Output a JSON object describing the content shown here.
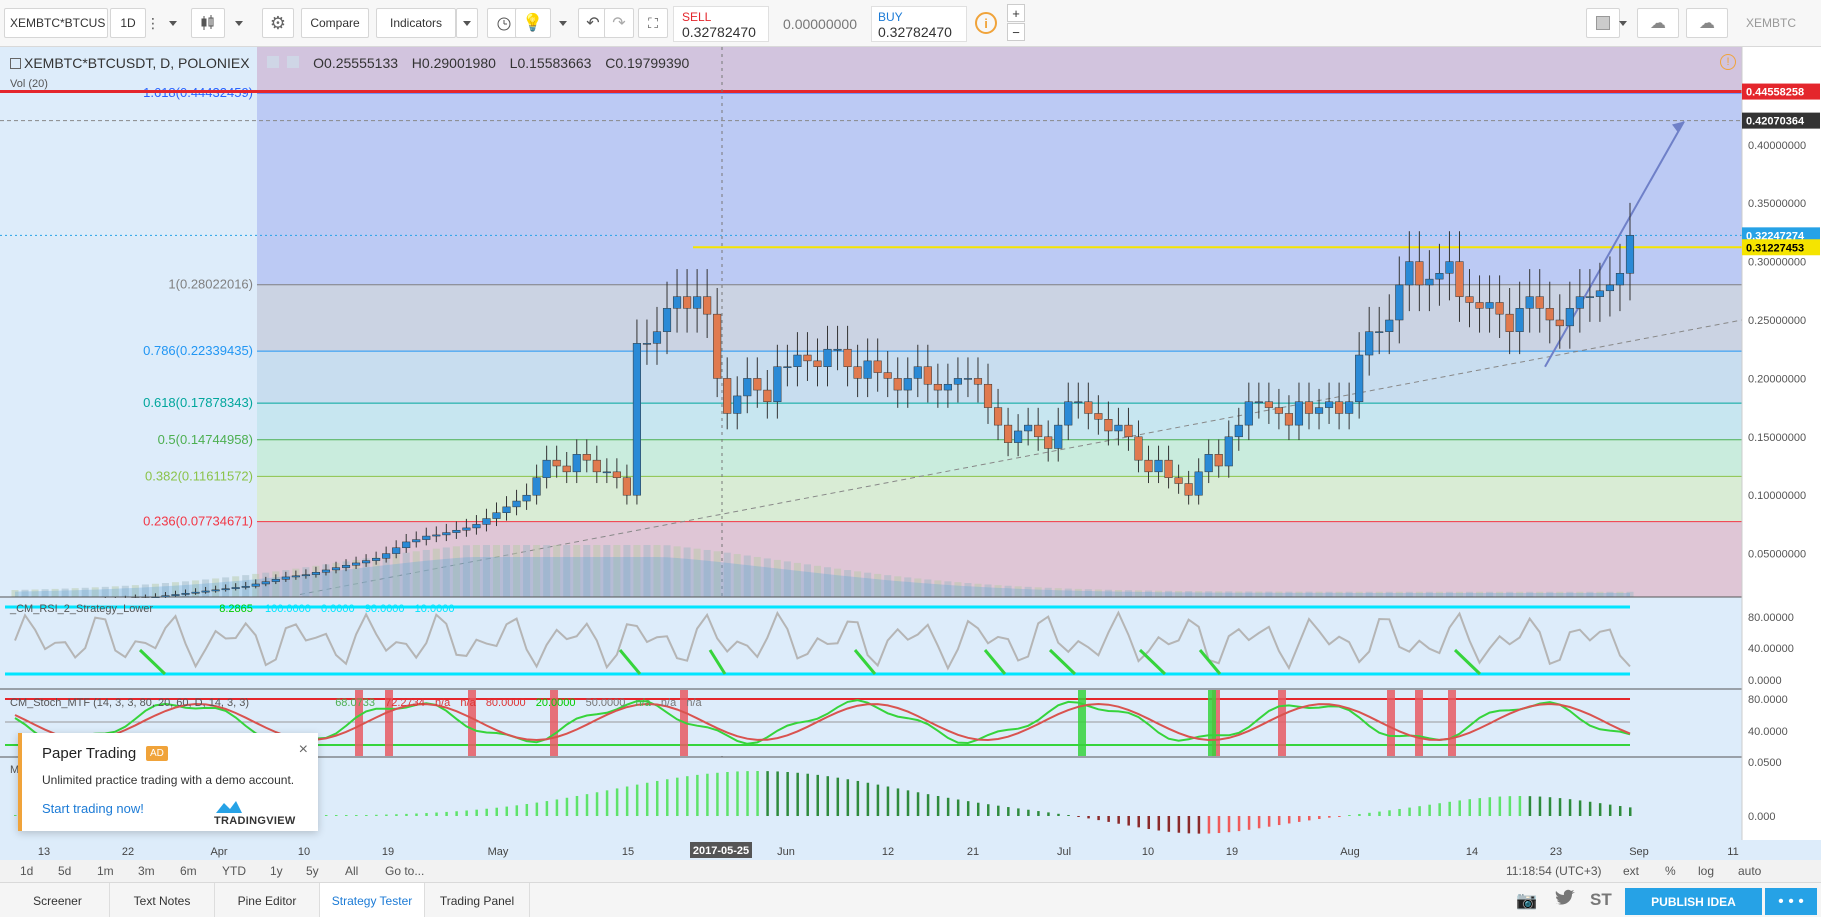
{
  "toolbar": {
    "symbol": "XEMBTC*BTCUS",
    "interval": "1D",
    "compare_label": "Compare",
    "indicators_label": "Indicators",
    "sell_label": "SELL",
    "sell_price": "0.32782470",
    "spread": "0.00000000",
    "buy_label": "BUY",
    "buy_price": "0.32782470",
    "info_icon": "i",
    "right_symbol": "XEMBTC"
  },
  "legend": {
    "title": "XEMBTC*BTCUSDT, D, POLONIEX",
    "open": "0.25555133",
    "high": "0.29001980",
    "low": "0.15583663",
    "close": "0.19799390",
    "vol_label": "Vol (20)"
  },
  "fib_levels": [
    {
      "label": "1.618(0.44432459)",
      "value": 0.44432459,
      "color": "#2962ff"
    },
    {
      "label": "1(0.28022016)",
      "value": 0.28022016,
      "color": "#808080"
    },
    {
      "label": "0.786(0.22339435)",
      "value": 0.22339435,
      "color": "#2196f3"
    },
    {
      "label": "0.618(0.17878343)",
      "value": 0.17878343,
      "color": "#00a69c"
    },
    {
      "label": "0.5(0.14744958)",
      "value": 0.14744958,
      "color": "#4caf50"
    },
    {
      "label": "0.382(0.11611572)",
      "value": 0.11611572,
      "color": "#8bc34a"
    },
    {
      "label": "0.236(0.07734671)",
      "value": 0.07734671,
      "color": "#f23645"
    }
  ],
  "price_scale": {
    "ticks": [
      "0.40000000",
      "0.35000000",
      "0.30000000",
      "0.25000000",
      "0.20000000",
      "0.15000000",
      "0.10000000",
      "0.05000000"
    ],
    "tick_values": [
      0.4,
      0.35,
      0.3,
      0.25,
      0.2,
      0.15,
      0.1,
      0.05
    ],
    "labels": [
      {
        "text": "0.44558258",
        "value": 0.44558258,
        "color": "#e4262c"
      },
      {
        "text": "0.42070364",
        "value": 0.42070364,
        "color": "#333333"
      },
      {
        "text": "0.32247274",
        "value": 0.32247274,
        "color": "#26a2e6"
      },
      {
        "text": "0.31227453",
        "value": 0.31227453,
        "color": "#f5e400"
      }
    ]
  },
  "rsi": {
    "label": "_CM_RSI_2_Strategy_Lower",
    "value": "8.2865",
    "upper": "100.0000",
    "lower": "0.0000",
    "ob": "90.0000",
    "os": "10.0000",
    "ticks": [
      "80.00000",
      "40.00000",
      "0.0000"
    ]
  },
  "stoch": {
    "label": "CM_Stoch_MTF (14, 3, 3, 80, 20, 60, D, 14, 3, 3)",
    "v1": "68.0733",
    "v2": "72.2734",
    "v3": "n/a",
    "v4": "n/a",
    "v5": "80.0000",
    "v6": "20.0000",
    "v7": "50.0000",
    "v8": "n/a",
    "v9": "n/a",
    "v10": "n/a",
    "ticks": [
      "80.0000",
      "40.0000"
    ]
  },
  "macd": {
    "label": "M",
    "ticks": [
      "0.0500",
      "0.000"
    ]
  },
  "time_axis": {
    "labels": [
      "13",
      "22",
      "Apr",
      "10",
      "19",
      "May",
      "15",
      "Jun",
      "12",
      "21",
      "Jul",
      "10",
      "19",
      "Aug",
      "14",
      "23",
      "Sep",
      "11"
    ],
    "highlight": "2017-05-25"
  },
  "bottom": {
    "ranges": [
      "1d",
      "5d",
      "1m",
      "3m",
      "6m",
      "YTD",
      "1y",
      "5y",
      "All"
    ],
    "goto": "Go to...",
    "clock": "11:18:54 (UTC+3)",
    "ext": "ext",
    "pct": "%",
    "log": "log",
    "auto": "auto"
  },
  "popup": {
    "title": "Paper Trading",
    "badge": "AD",
    "text": "Unlimited practice trading with a demo account.",
    "link": "Start trading now!",
    "brand": "TRADINGVIEW",
    "close": "×"
  },
  "footer": {
    "tabs": [
      "Screener",
      "Text Notes",
      "Pine Editor",
      "Strategy Tester",
      "Trading Panel"
    ],
    "active": "Strategy Tester",
    "publish": "PUBLISH IDEA",
    "more": "• • •",
    "st": "ST"
  },
  "chart_data": {
    "type": "candlestick",
    "symbol": "XEMBTC*BTCUSDT",
    "x_labels": [
      "13",
      "22",
      "Apr",
      "10",
      "19",
      "May",
      "15",
      "Jun",
      "12",
      "21",
      "Jul",
      "10",
      "19",
      "Aug",
      "14",
      "23",
      "Sep"
    ],
    "ylim": [
      0.0,
      0.46
    ],
    "closes": [
      0.005,
      0.006,
      0.006,
      0.007,
      0.007,
      0.008,
      0.008,
      0.008,
      0.009,
      0.01,
      0.01,
      0.011,
      0.012,
      0.012,
      0.013,
      0.014,
      0.015,
      0.016,
      0.017,
      0.018,
      0.019,
      0.02,
      0.021,
      0.022,
      0.024,
      0.026,
      0.028,
      0.03,
      0.031,
      0.032,
      0.034,
      0.036,
      0.038,
      0.04,
      0.042,
      0.044,
      0.046,
      0.05,
      0.055,
      0.06,
      0.062,
      0.065,
      0.066,
      0.068,
      0.07,
      0.072,
      0.075,
      0.08,
      0.085,
      0.09,
      0.095,
      0.1,
      0.115,
      0.13,
      0.125,
      0.12,
      0.135,
      0.13,
      0.12,
      0.12,
      0.115,
      0.1,
      0.23,
      0.23,
      0.24,
      0.26,
      0.27,
      0.26,
      0.27,
      0.255,
      0.2,
      0.17,
      0.185,
      0.2,
      0.19,
      0.18,
      0.21,
      0.21,
      0.22,
      0.215,
      0.21,
      0.225,
      0.225,
      0.21,
      0.2,
      0.215,
      0.205,
      0.2,
      0.19,
      0.2,
      0.21,
      0.195,
      0.19,
      0.195,
      0.2,
      0.2,
      0.195,
      0.175,
      0.16,
      0.145,
      0.155,
      0.16,
      0.15,
      0.14,
      0.16,
      0.18,
      0.18,
      0.17,
      0.165,
      0.155,
      0.16,
      0.15,
      0.13,
      0.12,
      0.13,
      0.115,
      0.11,
      0.1,
      0.12,
      0.135,
      0.125,
      0.15,
      0.16,
      0.18,
      0.18,
      0.175,
      0.17,
      0.16,
      0.18,
      0.17,
      0.175,
      0.18,
      0.17,
      0.18,
      0.22,
      0.24,
      0.24,
      0.25,
      0.28,
      0.3,
      0.28,
      0.285,
      0.29,
      0.3,
      0.27,
      0.265,
      0.26,
      0.265,
      0.255,
      0.24,
      0.26,
      0.27,
      0.26,
      0.25,
      0.245,
      0.26,
      0.27,
      0.27,
      0.275,
      0.28,
      0.29,
      0.32247274
    ]
  }
}
